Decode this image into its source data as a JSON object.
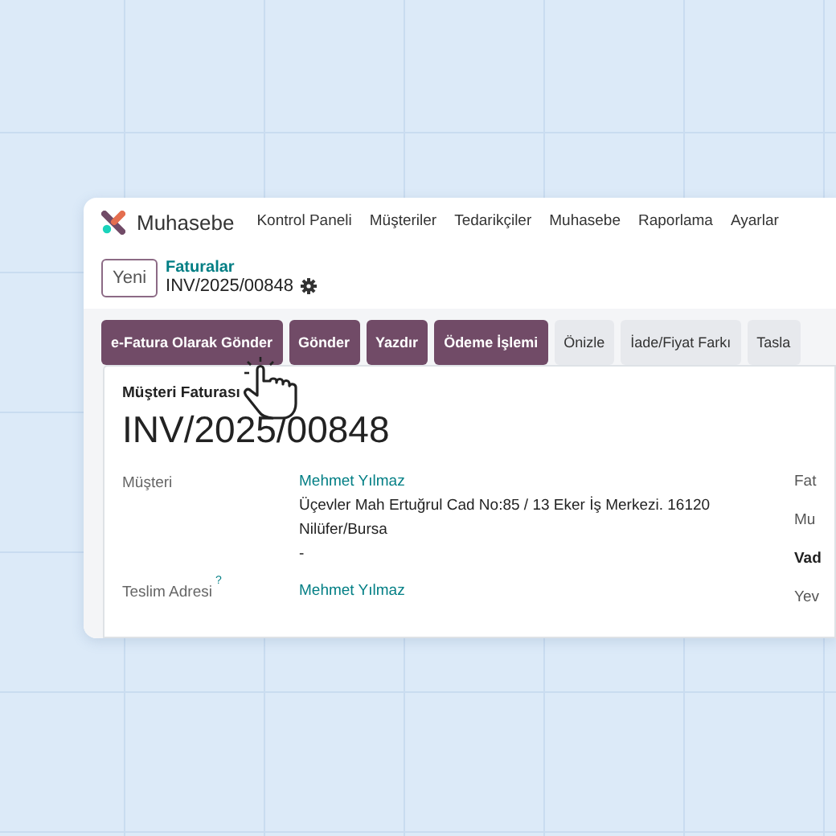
{
  "app": {
    "name": "Muhasebe"
  },
  "menu": [
    {
      "label": "Kontrol Paneli"
    },
    {
      "label": "Müşteriler"
    },
    {
      "label": "Tedarikçiler"
    },
    {
      "label": "Muhasebe"
    },
    {
      "label": "Raporlama"
    },
    {
      "label": "Ayarlar"
    }
  ],
  "new_button": "Yeni",
  "breadcrumb": {
    "parent": "Faturalar",
    "current": "INV/2025/00848"
  },
  "actions": [
    {
      "label": "e-Fatura Olarak Gönder",
      "kind": "primary"
    },
    {
      "label": "Gönder",
      "kind": "primary"
    },
    {
      "label": "Yazdır",
      "kind": "primary"
    },
    {
      "label": "Ödeme İşlemi",
      "kind": "primary"
    },
    {
      "label": "Önizle",
      "kind": "secondary"
    },
    {
      "label": "İade/Fiyat Farkı",
      "kind": "secondary"
    },
    {
      "label": "Tasla",
      "kind": "secondary"
    }
  ],
  "sheet": {
    "type_label": "Müşteri Faturası",
    "number": "INV/2025/00848",
    "fields": [
      {
        "label": "Müşteri",
        "values": [
          {
            "text": "Mehmet Yılmaz",
            "kind": "link"
          },
          {
            "text": "Üçevler Mah Ertuğrul Cad No:85 / 13 Eker İş Merkezi. 16120",
            "kind": "text"
          },
          {
            "text": "Nilüfer/Bursa",
            "kind": "text"
          },
          {
            "text": "-",
            "kind": "text"
          }
        ]
      },
      {
        "label": "Teslim Adresi",
        "help": "?",
        "values": [
          {
            "text": "Mehmet Yılmaz",
            "kind": "link"
          }
        ]
      }
    ],
    "side_fields": [
      {
        "label": "Fat",
        "bold": false
      },
      {
        "label": "Mu",
        "bold": false
      },
      {
        "label": "Vad",
        "bold": true
      },
      {
        "label": "Yev",
        "bold": false
      }
    ]
  }
}
